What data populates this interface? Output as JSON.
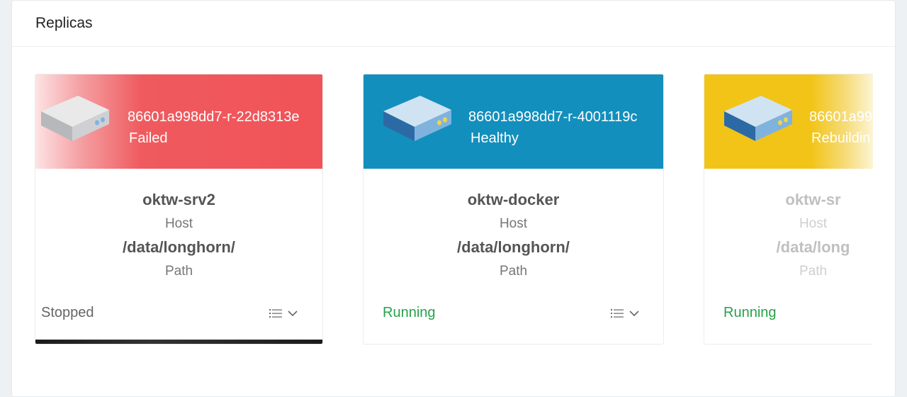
{
  "panel": {
    "title": "Replicas"
  },
  "replicas": [
    {
      "name": "86601a998dd7-r-22d8313e",
      "state": "Failed",
      "host": "oktw-srv2",
      "host_label": "Host",
      "path": "/data/longhorn/",
      "path_label": "Path",
      "status": "Stopped",
      "state_color": "#f05358"
    },
    {
      "name": "86601a998dd7-r-4001119c",
      "state": "Healthy",
      "host": "oktw-docker",
      "host_label": "Host",
      "path": "/data/longhorn/",
      "path_label": "Path",
      "status": "Running",
      "state_color": "#138fbd"
    },
    {
      "name": "86601a99",
      "state": "Rebuildin",
      "host": "oktw-sr",
      "host_label": "Host",
      "path": "/data/long",
      "path_label": "Path",
      "status": "Running",
      "state_color": "#f2c417"
    }
  ],
  "icons": {
    "disk": "disk-icon",
    "menu": "list-icon",
    "caret": "chevron-down-icon"
  },
  "colors": {
    "running": "#27a24a",
    "stopped": "#666666"
  }
}
